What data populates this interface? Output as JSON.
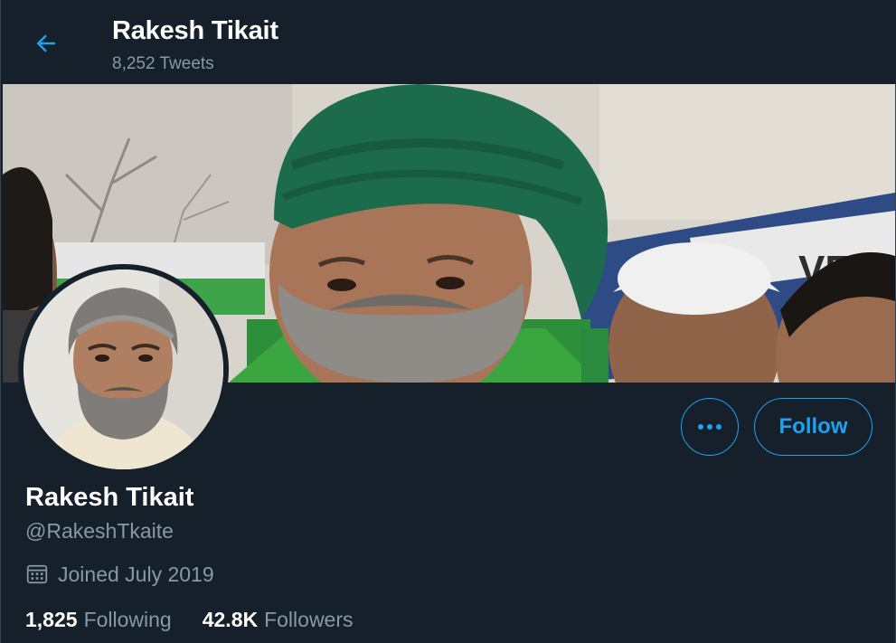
{
  "header": {
    "name": "Rakesh Tikait",
    "tweet_count": "8,252 Tweets"
  },
  "profile": {
    "name": "Rakesh Tikait",
    "handle": "@RakeshTkaite",
    "joined": "Joined July 2019",
    "following_count": "1,825",
    "following_label": "Following",
    "followers_count": "42.8K",
    "followers_label": "Followers"
  },
  "actions": {
    "follow_label": "Follow",
    "more_icon": "more-horizontal-icon"
  },
  "colors": {
    "background": "#15202b",
    "accent": "#1da1f2",
    "secondary_text": "#8899a6",
    "primary_text": "#ffffff"
  }
}
